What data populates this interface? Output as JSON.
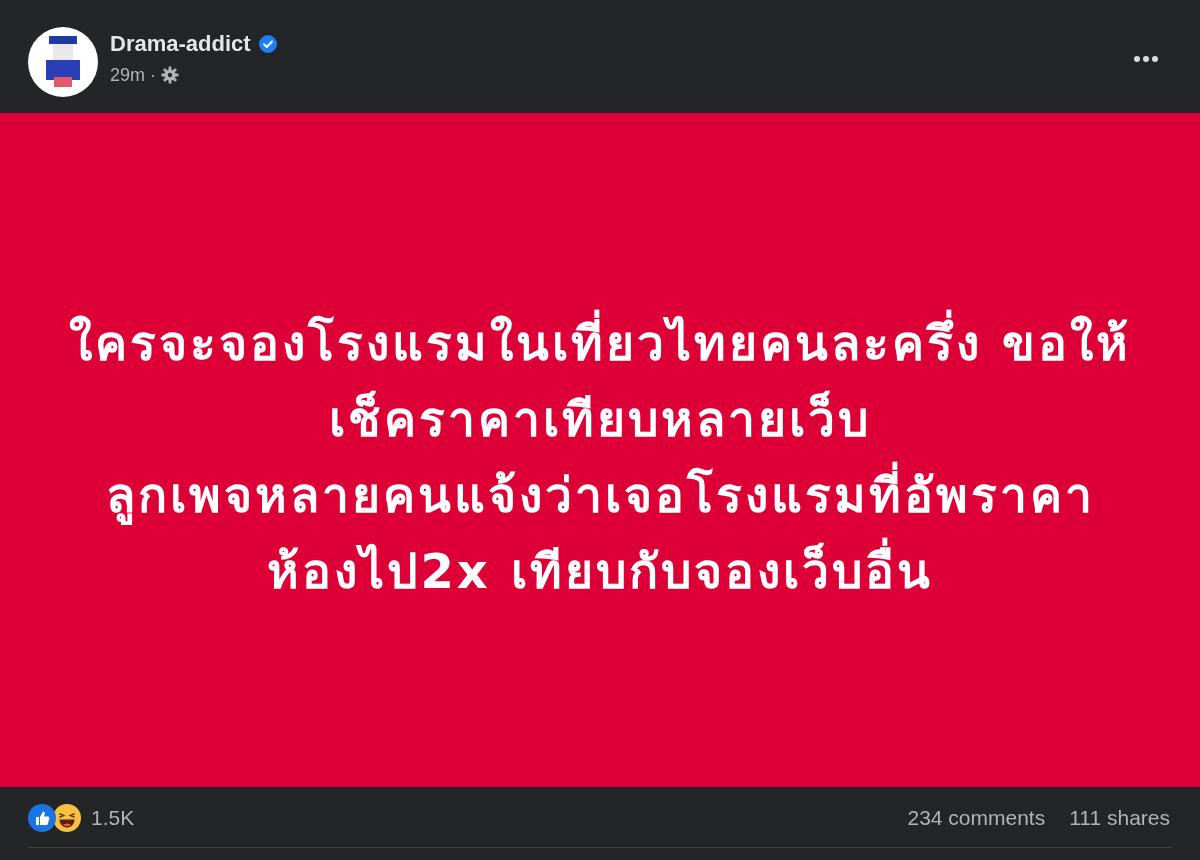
{
  "post_header": {
    "author": {
      "name": "Drama-addict",
      "verified": true
    },
    "time": "29m",
    "separator": "·"
  },
  "post_content": {
    "lines": [
      "ใครจะจองโรงแรมในเที่ยวไทยคนละครึ่ง ขอให้",
      "เช็คราคาเทียบหลายเว็บ",
      "ลูกเพจหลายคนแจ้งว่าเจอโรงแรมที่อัพราคา",
      "ห้องไป2x เทียบกับจองเว็บอื่น"
    ]
  },
  "post_footer": {
    "reactions": [
      {
        "kind": "like"
      },
      {
        "kind": "haha"
      }
    ],
    "reaction_count": "1.5K",
    "comments": "234 comments",
    "shares": "111 shares"
  }
}
